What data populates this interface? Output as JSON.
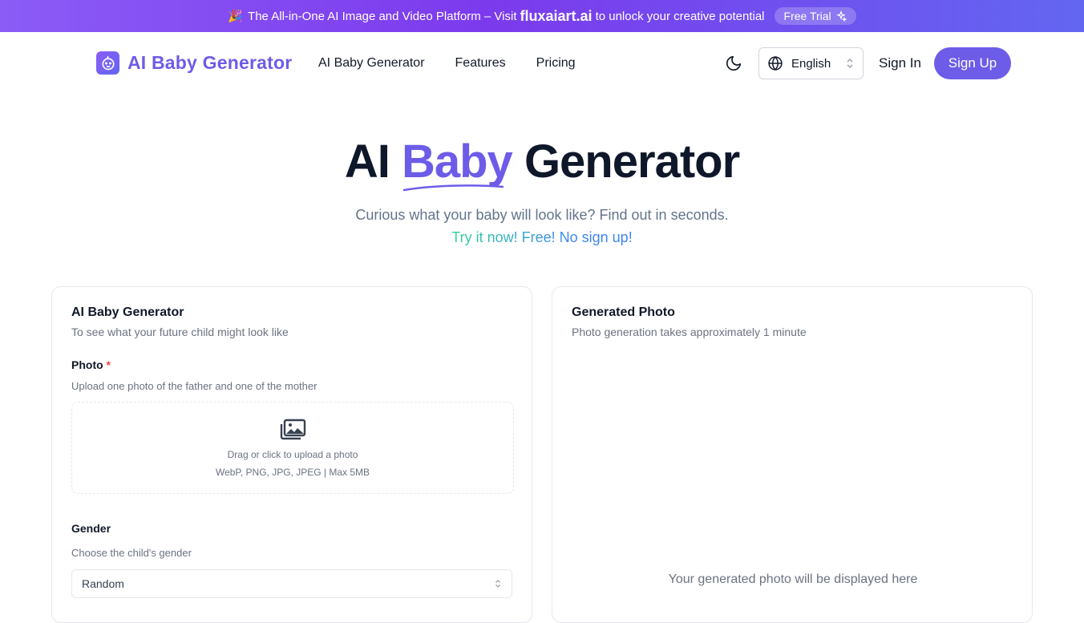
{
  "banner": {
    "text_before": "The All-in-One AI Image and Video Platform – Visit",
    "brand": "fluxaiart.ai",
    "text_after": "to unlock your creative potential",
    "trial_label": "Free Trial"
  },
  "nav": {
    "logo_text": "AI Baby Generator",
    "links": [
      "AI Baby Generator",
      "Features",
      "Pricing"
    ],
    "language": "English",
    "signin_label": "Sign In",
    "signup_label": "Sign Up"
  },
  "hero": {
    "title_start": "AI",
    "title_accent": "Baby",
    "title_end": "Generator",
    "subtitle": "Curious what your baby will look like? Find out in seconds.",
    "cta": "Try it now! Free! No sign up!"
  },
  "form_card": {
    "title": "AI Baby Generator",
    "description": "To see what your future child might look like",
    "photo_label": "Photo",
    "photo_required_mark": "*",
    "photo_help": "Upload one photo of the father and one of the mother",
    "upload_line1": "Drag or click to upload a photo",
    "upload_line2": "WebP, PNG, JPG, JPEG | Max 5MB",
    "gender_label": "Gender",
    "gender_help": "Choose the child's gender",
    "gender_value": "Random"
  },
  "result_card": {
    "title": "Generated Photo",
    "description": "Photo generation takes approximately 1 minute",
    "placeholder": "Your generated photo will be displayed here"
  },
  "colors": {
    "accent": "#6d5ce8",
    "banner_start": "#8b5cf6",
    "banner_end": "#6366f1",
    "cta_start": "#34d399",
    "cta_end": "#3b82f6"
  },
  "icons": {
    "banner": "party-popper-icon",
    "trial": "sparkles-icon",
    "logo": "baby-face-icon",
    "theme": "moon-icon",
    "language": "globe-icon",
    "upload": "images-icon"
  }
}
